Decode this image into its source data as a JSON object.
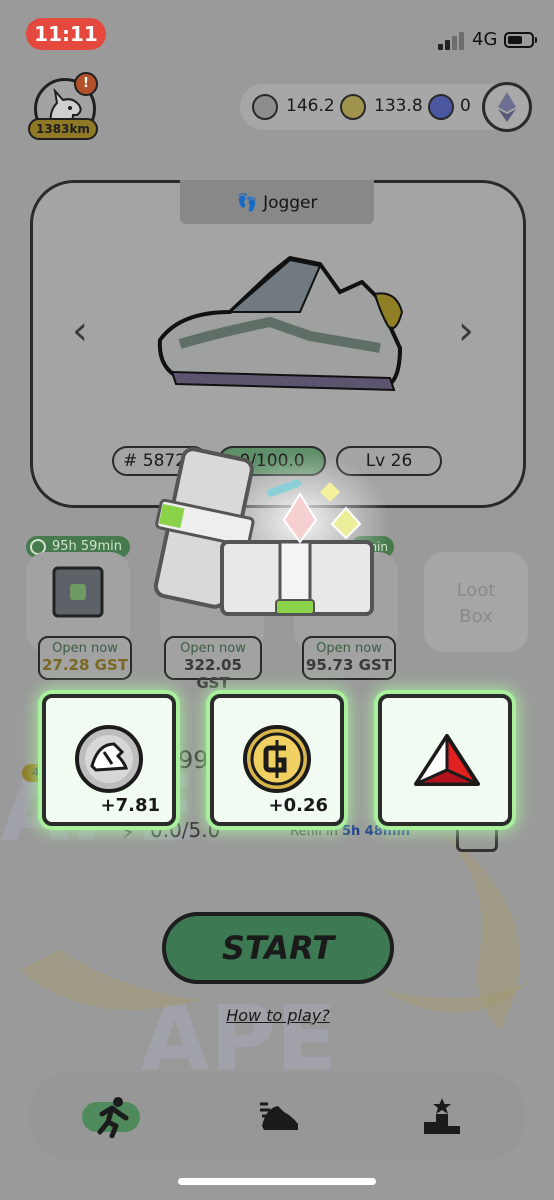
{
  "status_bar": {
    "time": "11:11",
    "network": "4G"
  },
  "profile": {
    "badge": "!",
    "distance": "1383km"
  },
  "balances": {
    "gst": "146.2",
    "gmt": "133.8",
    "sol": "0"
  },
  "sneaker": {
    "type": "Jogger",
    "id": "58724",
    "durability": "0/100.0",
    "level": "Lv 26"
  },
  "boxes": {
    "timer": "95h 59min",
    "timer2": "min",
    "items": [
      {
        "label": "Open now",
        "price": "27.28 GST"
      },
      {
        "label": "Open now",
        "price": "322.05 GST"
      },
      {
        "label": "Open now",
        "price": "95.73 GST"
      }
    ],
    "loot_line1": "Loot",
    "loot_line2": "Box"
  },
  "stats": {
    "level_badge": "40",
    "value": "99/",
    "energy": "0.0/5.0",
    "refill_prefix": "Refill in",
    "refill_time": "5h 48min"
  },
  "rewards": [
    {
      "icon": "gst-coin-icon",
      "amount": "+7.81"
    },
    {
      "icon": "gmt-coin-icon",
      "amount": "+0.26"
    },
    {
      "icon": "red-gem-icon",
      "amount": ""
    }
  ],
  "start_label": "START",
  "how_to_play": "How to play?",
  "colors": {
    "accent_green": "#a9ef9c",
    "start_green": "#3d7a54",
    "time_red": "#e5483d"
  }
}
